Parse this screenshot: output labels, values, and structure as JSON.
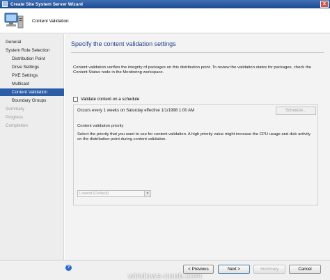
{
  "window": {
    "title": "Create Site System Server Wizard",
    "close_glyph": "x"
  },
  "header": {
    "title": "Content Validation"
  },
  "sidebar": {
    "items": [
      {
        "label": "General"
      },
      {
        "label": "System Role Selection"
      },
      {
        "label": "Distribution Point"
      },
      {
        "label": "Drive Settings"
      },
      {
        "label": "PXE Settings"
      },
      {
        "label": "Multicast"
      },
      {
        "label": "Content Validation"
      },
      {
        "label": "Boundary Groups"
      },
      {
        "label": "Summary"
      },
      {
        "label": "Progress"
      },
      {
        "label": "Completion"
      }
    ],
    "active_index": 6
  },
  "main": {
    "title": "Specify the content validation settings",
    "description": "Content validation verifies the integrity of packages on this distribution point. To review the validation states for packages, check the Content Status node in the Monitoring workspace.",
    "checkbox_label": "Validate content on a schedule",
    "checkbox_checked": false,
    "schedule_text": "Occurs every 1 weeks on Saturday effective 1/1/1998 1:00 AM",
    "schedule_button": "Schedule...",
    "priority_heading": "Content validation priority",
    "priority_description": "Select the priority that you want to use for content validation. A high priority value might increase the CPU usage and disk activity on the distribution point during content validation.",
    "priority_value": "Lowest (Default)"
  },
  "footer": {
    "help_glyph": "?",
    "previous": "< Previous",
    "next": "Next >",
    "summary": "Summary",
    "cancel": "Cancel",
    "watermark": "windows-noob.com"
  },
  "colors": {
    "accent": "#2c5ea8",
    "title_blue": "#1f3f8a",
    "titlebar": "#1d4a8f"
  }
}
